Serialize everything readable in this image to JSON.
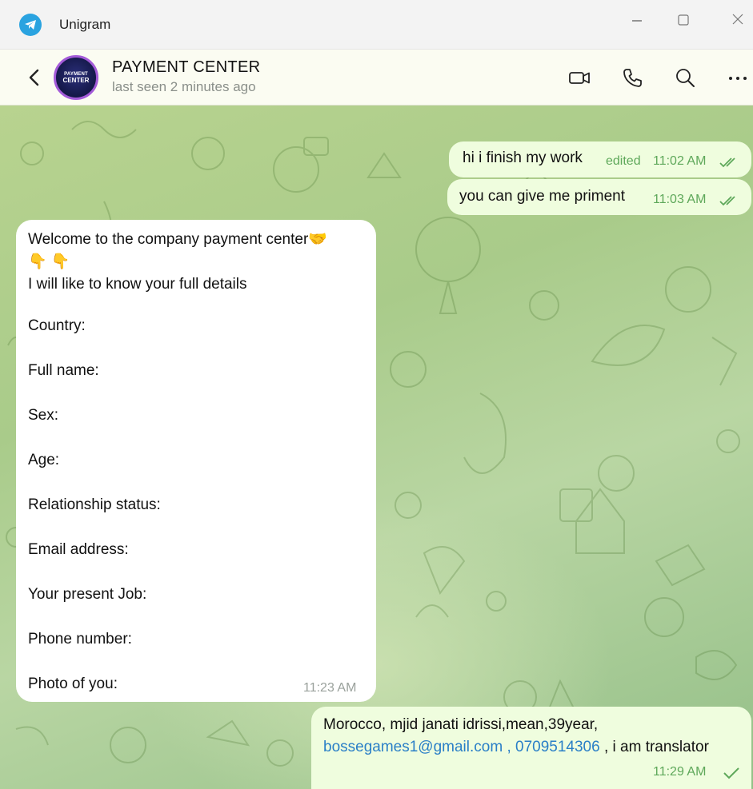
{
  "window": {
    "title": "Unigram",
    "controls": [
      "minimize",
      "maximize",
      "close"
    ]
  },
  "chat_header": {
    "avatar_text": [
      "PAYMENT",
      "CENTER"
    ],
    "name": "PAYMENT CENTER",
    "status": "last seen 2 minutes ago",
    "icons": [
      "back-arrow-icon",
      "video-call-icon",
      "phone-icon",
      "search-icon",
      "more-icon"
    ]
  },
  "messages": {
    "out1": {
      "text": "hi i finish my work",
      "edited": "edited",
      "time": "11:02 AM",
      "status": "read"
    },
    "out2": {
      "text": "you can give me priment",
      "time": "11:03 AM",
      "status": "read"
    },
    "in1": {
      "line1": "Welcome to the company payment center🤝",
      "line2": "👇 👇",
      "line3": "I will like to know your full details",
      "fields": [
        "Country:",
        "Full name:",
        "Sex:",
        "Age:",
        "Relationship status:",
        "Email address:",
        "Your present Job:",
        "Phone number:",
        "Photo of you:"
      ],
      "time": "11:23 AM"
    },
    "out3": {
      "line1": "Morocco, mjid janati idrissi,mean,39year,",
      "email": "bossegames1@gmail.com",
      "sep1": " , ",
      "phone": "0709514306",
      "tail": " , i am translator",
      "time": "11:29 AM",
      "status": "sent"
    }
  },
  "colors": {
    "outgoing_bubble": "#effdde",
    "incoming_bubble": "#ffffff",
    "meta_green": "#5ea85a",
    "link": "#2a7fc7"
  }
}
